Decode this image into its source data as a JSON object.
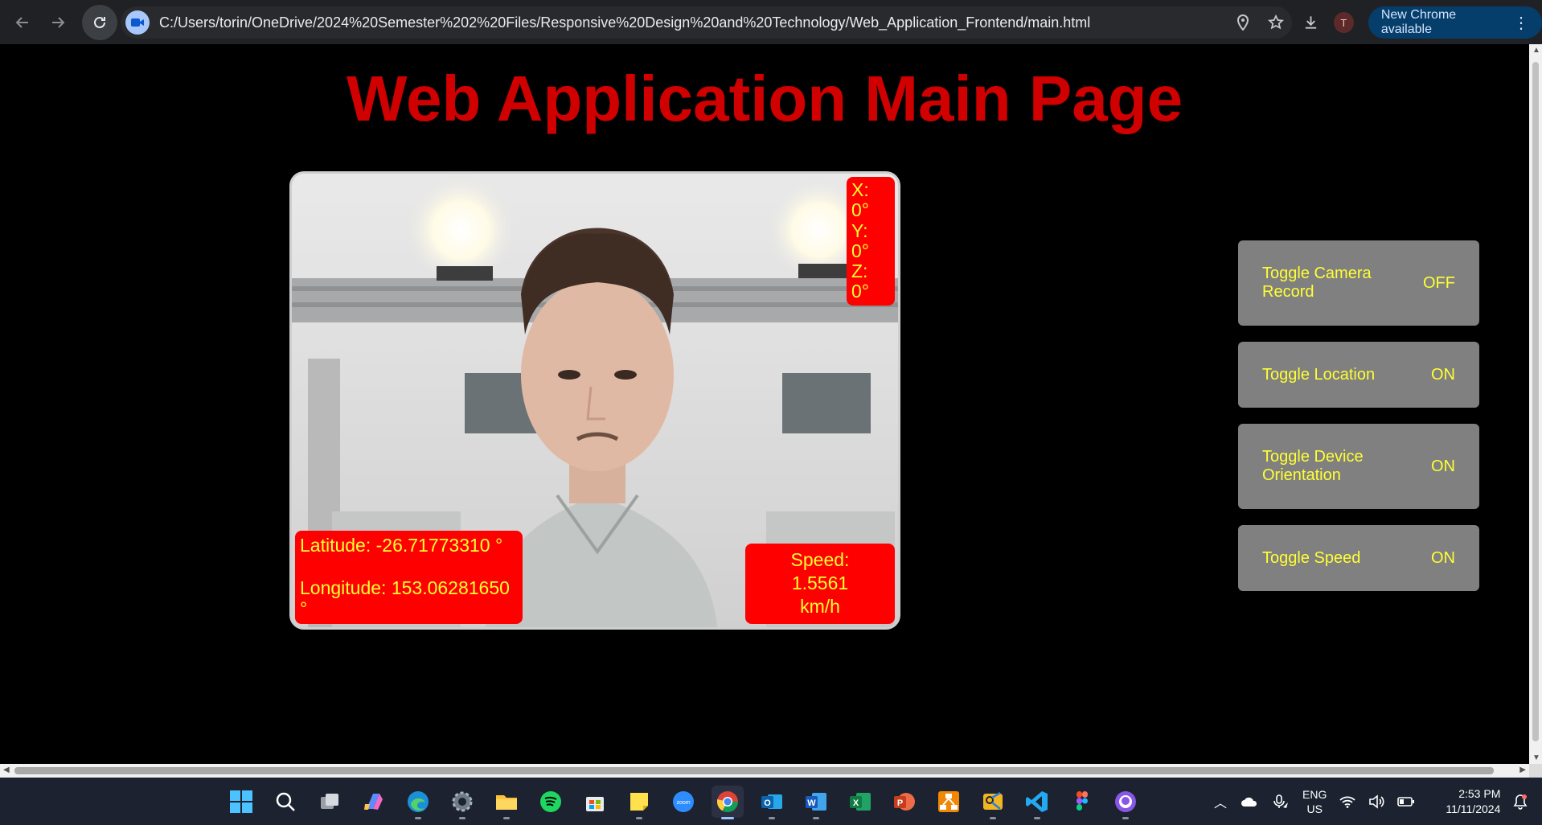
{
  "browser": {
    "url": "C:/Users/torin/OneDrive/2024%20Semester%202%20Files/Responsive%20Design%20and%20Technology/Web_Application_Frontend/main.html",
    "profile_initial": "T",
    "update_label": "New Chrome available"
  },
  "page": {
    "title": "Web Application Main Page"
  },
  "camera": {
    "orientation": {
      "x": "X: 0°",
      "y": "Y: 0°",
      "z": "Z: 0°"
    },
    "latitude": "Latitude: -26.71773310 °",
    "longitude": "Longitude: 153.06281650 °",
    "speed_line1": "Speed:",
    "speed_line2": "1.5561",
    "speed_line3": "km/h"
  },
  "toggles": [
    {
      "label": "Toggle Camera Record",
      "state": "OFF"
    },
    {
      "label": "Toggle Location",
      "state": "ON"
    },
    {
      "label": "Toggle Device Orientation",
      "state": "ON"
    },
    {
      "label": "Toggle Speed",
      "state": "ON"
    }
  ],
  "taskbar": {
    "language_line1": "ENG",
    "language_line2": "US",
    "time": "2:53 PM",
    "date": "11/11/2024"
  },
  "colors": {
    "title_red": "#d10000",
    "overlay_red": "#ff0000",
    "overlay_text": "#ffff33",
    "toggle_bg": "#808080"
  }
}
